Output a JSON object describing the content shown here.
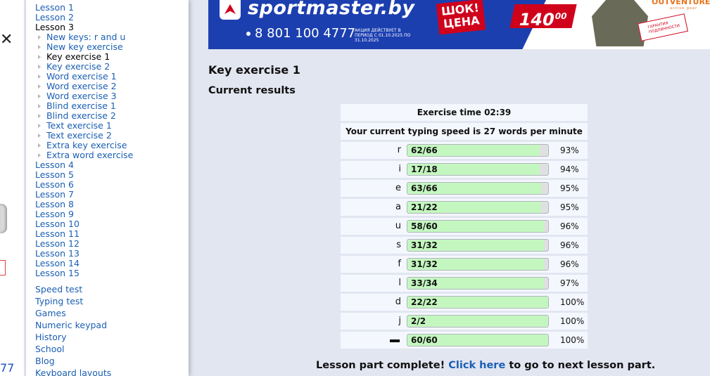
{
  "left_strip": {
    "edge_text": "77"
  },
  "sidebar": {
    "lessons_before": [
      "Lesson 1",
      "Lesson 2"
    ],
    "current_lesson": "Lesson 3",
    "sub_items": [
      {
        "label": "New keys: r and u",
        "current": false
      },
      {
        "label": "New key exercise",
        "current": false
      },
      {
        "label": "Key exercise 1",
        "current": true
      },
      {
        "label": "Key exercise 2",
        "current": false
      },
      {
        "label": "Word exercise 1",
        "current": false
      },
      {
        "label": "Word exercise 2",
        "current": false
      },
      {
        "label": "Word exercise 3",
        "current": false
      },
      {
        "label": "Blind exercise 1",
        "current": false
      },
      {
        "label": "Blind exercise 2",
        "current": false
      },
      {
        "label": "Text exercise 1",
        "current": false
      },
      {
        "label": "Text exercise 2",
        "current": false
      },
      {
        "label": "Extra key exercise",
        "current": false
      },
      {
        "label": "Extra word exercise",
        "current": false
      }
    ],
    "lessons_after": [
      "Lesson 4",
      "Lesson 5",
      "Lesson 6",
      "Lesson 7",
      "Lesson 8",
      "Lesson 9",
      "Lesson 10",
      "Lesson 11",
      "Lesson 12",
      "Lesson 13",
      "Lesson 14",
      "Lesson 15"
    ],
    "extra_links": [
      "Speed test",
      "Typing test",
      "Games",
      "Numeric keypad",
      "History",
      "School",
      "Blog",
      "Keyboard layouts"
    ]
  },
  "banner": {
    "brand": "sportmaster.by",
    "phone": "8 801 100 4777",
    "terms": "АКЦИЯ ДЕЙСТВУЕТ В ПЕРИОД С 01.10.2025 ПО 31.10.2025",
    "promo_line1": "ШОК!",
    "promo_line2": "ЦЕНА",
    "price": "140",
    "price_cents": "00",
    "warranty": "ГАРАНТИЯ ПОДЛИННОСТИ",
    "partner": "OUTVENTURE",
    "partner_sub": "active gear",
    "colors": {
      "blue": "#1c3fb0",
      "red": "#d0021b",
      "orange": "#e8741c"
    }
  },
  "main": {
    "title": "Key exercise 1",
    "results_heading": "Current results",
    "exercise_time_label": "Exercise time 02:39",
    "speed_label": "Your current typing speed is 27 words per minute",
    "rows": [
      {
        "key": "r",
        "fraction": "62/66",
        "percent": "93%",
        "fill": 0.94
      },
      {
        "key": "i",
        "fraction": "17/18",
        "percent": "94%",
        "fill": 0.94
      },
      {
        "key": "e",
        "fraction": "63/66",
        "percent": "95%",
        "fill": 0.95
      },
      {
        "key": "a",
        "fraction": "21/22",
        "percent": "95%",
        "fill": 0.95
      },
      {
        "key": "u",
        "fraction": "58/60",
        "percent": "96%",
        "fill": 0.97
      },
      {
        "key": "s",
        "fraction": "31/32",
        "percent": "96%",
        "fill": 0.97
      },
      {
        "key": "f",
        "fraction": "31/32",
        "percent": "96%",
        "fill": 0.97
      },
      {
        "key": "l",
        "fraction": "33/34",
        "percent": "97%",
        "fill": 0.97
      },
      {
        "key": "d",
        "fraction": "22/22",
        "percent": "100%",
        "fill": 1.0
      },
      {
        "key": "j",
        "fraction": "2/2",
        "percent": "100%",
        "fill": 1.0
      },
      {
        "key": "space",
        "fraction": "60/60",
        "percent": "100%",
        "fill": 1.0
      }
    ],
    "complete_prefix": "Lesson part complete!",
    "complete_link": "Click here",
    "complete_suffix": "to go to next lesson part.",
    "colors": {
      "bar_fill": "#c4f7c0",
      "link": "#1a5fb4",
      "page_bg": "#e2e6f1"
    }
  }
}
